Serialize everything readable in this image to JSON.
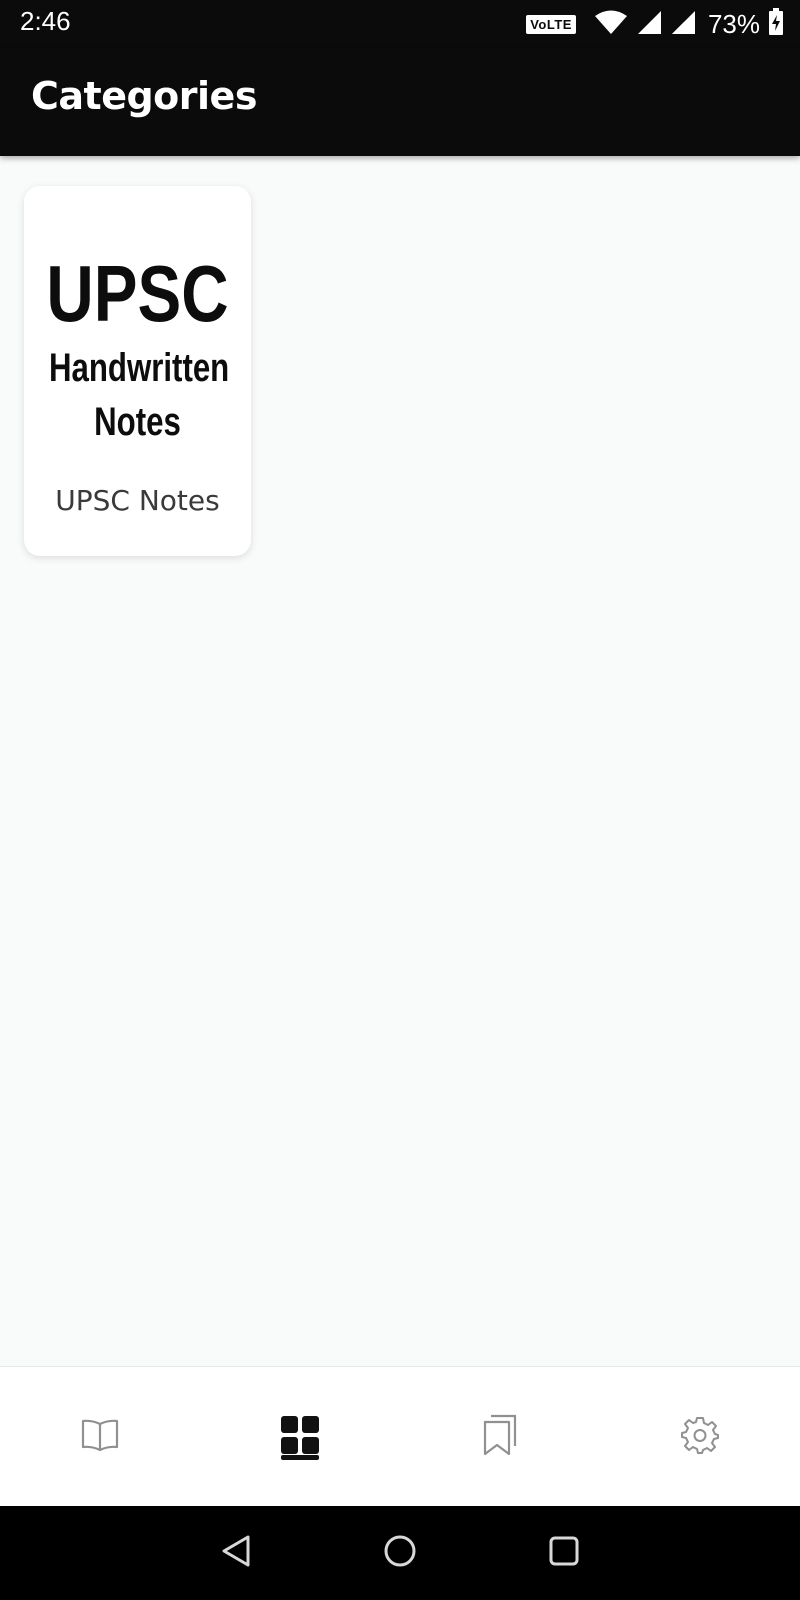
{
  "status_bar": {
    "time": "2:46",
    "network_badge": "VoLTE",
    "battery_percent": "73%",
    "icons": [
      "volte-badge",
      "wifi-icon",
      "signal-icon",
      "signal-icon",
      "battery-charging-icon"
    ]
  },
  "app_bar": {
    "title": "Categories"
  },
  "categories": [
    {
      "label": "UPSC Notes",
      "thumbnail_text": {
        "line1": "UPSC",
        "line2": "Handwritten",
        "line3": "Notes"
      }
    }
  ],
  "bottom_nav": {
    "items": [
      {
        "icon": "book-icon",
        "active": false
      },
      {
        "icon": "grid-icon",
        "active": true
      },
      {
        "icon": "bookmarks-icon",
        "active": false
      },
      {
        "icon": "gear-icon",
        "active": false
      }
    ]
  },
  "system_nav": {
    "buttons": [
      "back-icon",
      "home-icon",
      "recents-icon"
    ]
  },
  "colors": {
    "app_bar_bg": "#0b0b0b",
    "background": "#f9fbfa",
    "active_icon": "#111111",
    "inactive_icon": "#8e9190"
  }
}
